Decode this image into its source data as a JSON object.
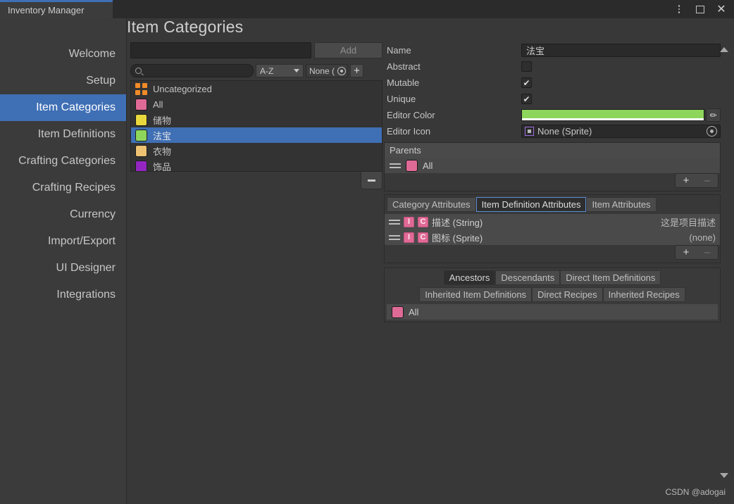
{
  "window": {
    "tab_title": "Inventory Manager",
    "controls": {
      "menu": "kebab-menu",
      "maximize": "maximize",
      "close": "✕"
    }
  },
  "page": {
    "title": "Item Categories"
  },
  "sidebar": {
    "items": [
      {
        "label": "Welcome",
        "selected": false
      },
      {
        "label": "Setup",
        "selected": false
      },
      {
        "label": "Item Categories",
        "selected": true
      },
      {
        "label": "Item Definitions",
        "selected": false
      },
      {
        "label": "Crafting Categories",
        "selected": false
      },
      {
        "label": "Crafting Recipes",
        "selected": false
      },
      {
        "label": "Currency",
        "selected": false
      },
      {
        "label": "Import/Export",
        "selected": false
      },
      {
        "label": "UI Designer",
        "selected": false
      },
      {
        "label": "Integrations",
        "selected": false
      }
    ]
  },
  "list_panel": {
    "add_input_value": "",
    "add_input_placeholder": "",
    "add_button": "Add",
    "search_value": "",
    "search_placeholder": "",
    "sort_value": "A-Z",
    "filter_value": "None (",
    "add_filter_button": "+",
    "remove_button": "–",
    "categories": [
      {
        "label": "Uncategorized",
        "color": "#f08b27",
        "swatch": "grid",
        "selected": false
      },
      {
        "label": "All",
        "color": "#e06a96",
        "swatch": "solid",
        "selected": false
      },
      {
        "label": "储物",
        "color": "#e8d83d",
        "swatch": "solid",
        "selected": false
      },
      {
        "label": "法宝",
        "color": "#8ed65b",
        "swatch": "solid",
        "selected": true
      },
      {
        "label": "衣物",
        "color": "#edc273",
        "swatch": "solid",
        "selected": false
      },
      {
        "label": "饰品",
        "color": "#9326c0",
        "swatch": "solid",
        "selected": false
      }
    ]
  },
  "inspector": {
    "fields": {
      "name_label": "Name",
      "name_value": "法宝",
      "abstract_label": "Abstract",
      "abstract_checked": false,
      "mutable_label": "Mutable",
      "mutable_checked": true,
      "unique_label": "Unique",
      "unique_checked": true,
      "editor_color_label": "Editor Color",
      "editor_color_value": "#8ed65b",
      "editor_icon_label": "Editor Icon",
      "editor_icon_value": "None (Sprite)"
    },
    "parents": {
      "header": "Parents",
      "items": [
        {
          "label": "All",
          "color": "#e06a96"
        }
      ],
      "add_button": "+",
      "remove_button": "–"
    },
    "attribute_tabs": [
      {
        "label": "Category Attributes",
        "active": false
      },
      {
        "label": "Item Definition Attributes",
        "active": true
      },
      {
        "label": "Item Attributes",
        "active": false
      }
    ],
    "attributes": [
      {
        "inherit_badge": "I",
        "category_badge": "C",
        "name": "描述 (String)",
        "value": "这是项目描述"
      },
      {
        "inherit_badge": "I",
        "category_badge": "C",
        "name": "图标 (Sprite)",
        "value": "(none)"
      }
    ],
    "attributes_add_button": "+",
    "attributes_remove_button": "–",
    "relation_tabs_row1": [
      {
        "label": "Ancestors",
        "active": true
      },
      {
        "label": "Descendants",
        "active": false
      },
      {
        "label": "Direct Item Definitions",
        "active": false
      }
    ],
    "relation_tabs_row2": [
      {
        "label": "Inherited Item Definitions",
        "active": false
      },
      {
        "label": "Direct Recipes",
        "active": false
      },
      {
        "label": "Inherited Recipes",
        "active": false
      }
    ],
    "relation_items": [
      {
        "label": "All",
        "color": "#e06a96"
      }
    ]
  },
  "watermark": "CSDN @adogai"
}
